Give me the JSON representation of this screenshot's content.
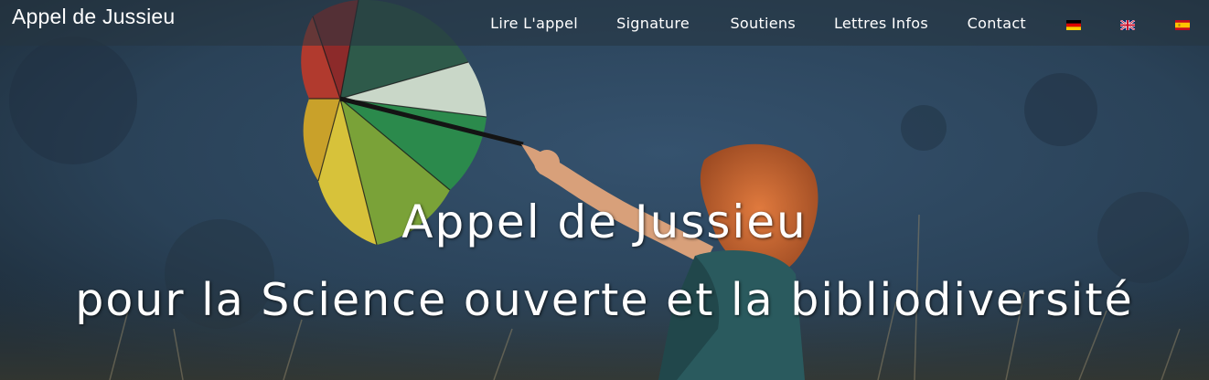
{
  "nav": {
    "brand": "Appel de Jussieu",
    "items": [
      {
        "label": "Lire L'appel"
      },
      {
        "label": "Signature"
      },
      {
        "label": "Soutiens"
      },
      {
        "label": "Lettres Infos"
      },
      {
        "label": "Contact"
      }
    ],
    "languages": [
      {
        "name": "german-flag-icon"
      },
      {
        "name": "uk-flag-icon"
      },
      {
        "name": "spanish-flag-icon"
      }
    ]
  },
  "hero": {
    "line1": "Appel de Jussieu",
    "line2": "pour la Science ouverte et la bibliodiversité"
  },
  "colors": {
    "sky": "#2e4a66",
    "navbar": "#263440",
    "text": "#ffffff"
  }
}
